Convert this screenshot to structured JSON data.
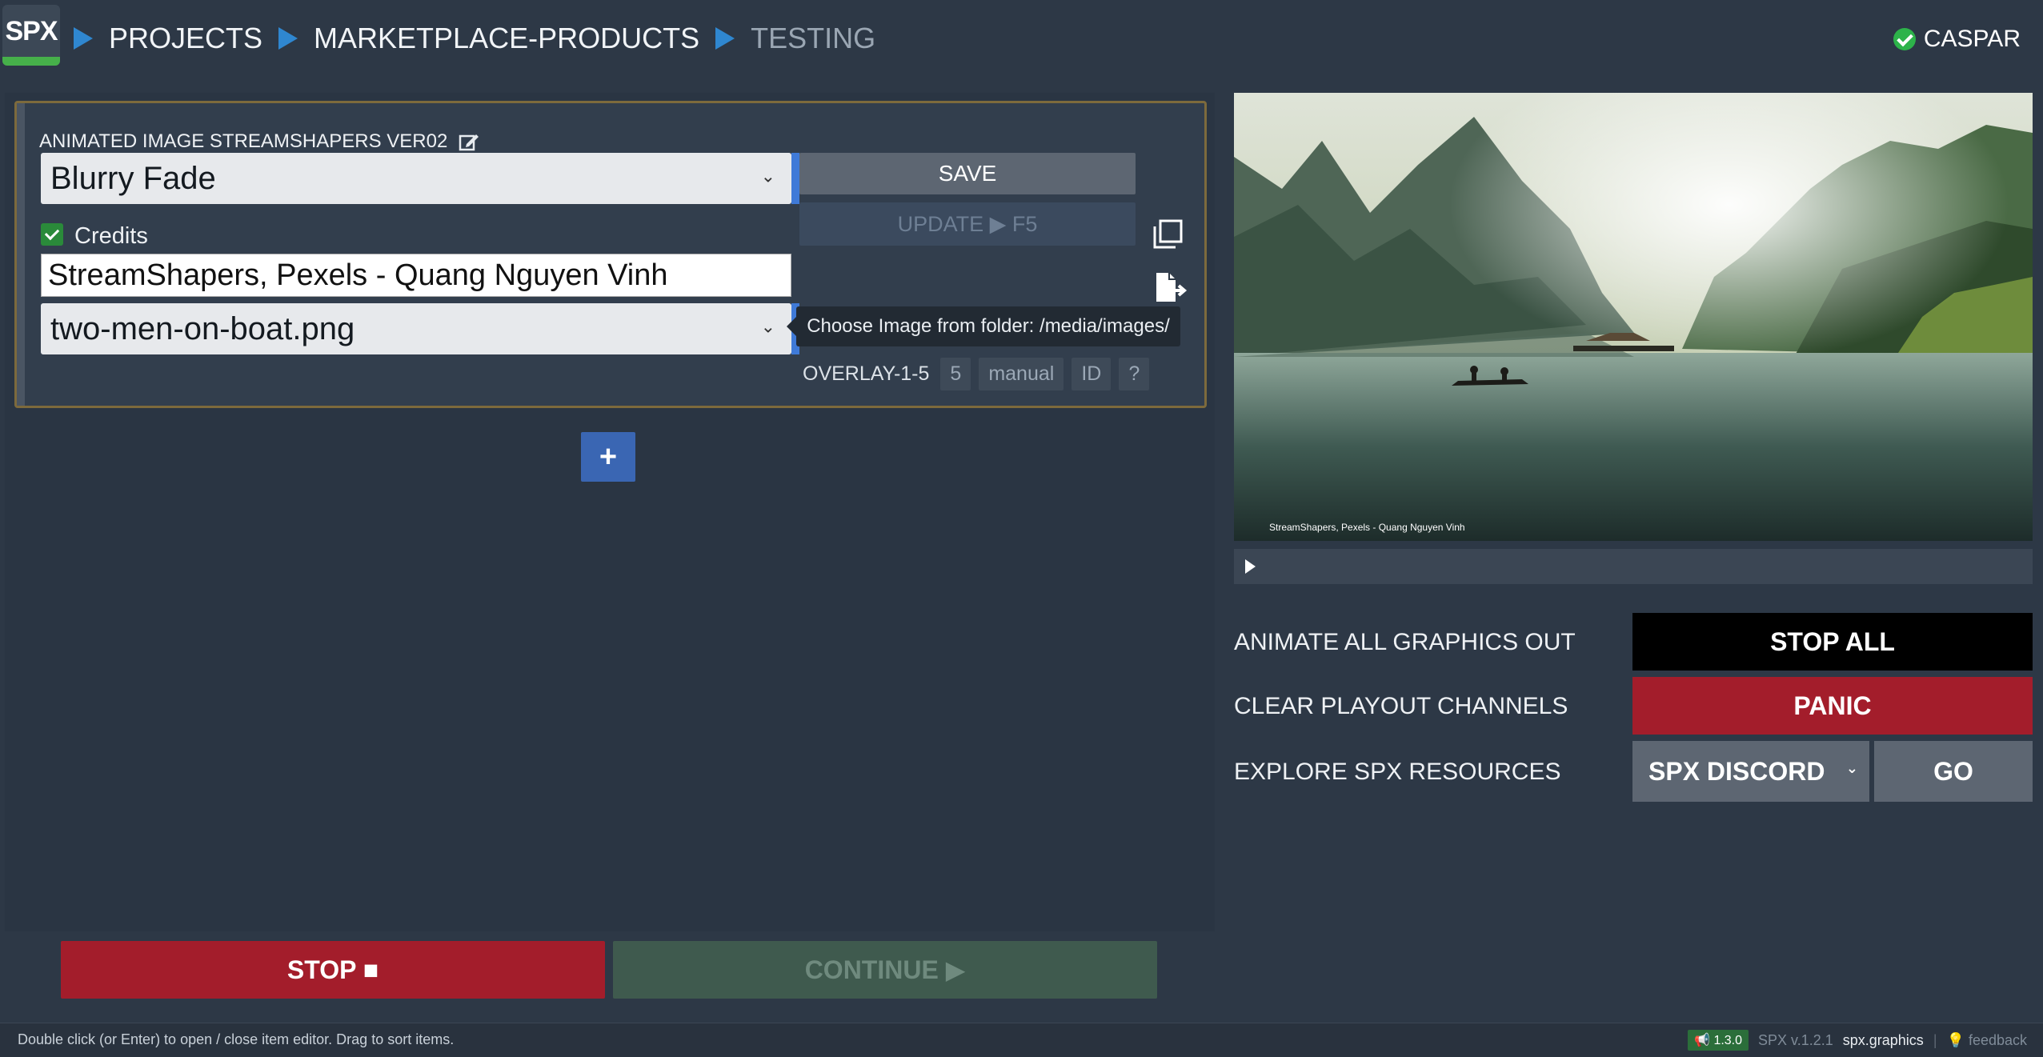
{
  "header": {
    "logo": "SPX",
    "breadcrumbs": [
      "PROJECTS",
      "MARKETPLACE-PRODUCTS",
      "TESTING"
    ],
    "server_name": "CASPAR"
  },
  "item": {
    "title": "ANIMATED IMAGE STREAMSHAPERS VER02",
    "effect_select": "Blurry Fade",
    "credits_label": "Credits",
    "credits_value": "StreamShapers, Pexels - Quang Nguyen Vinh",
    "image_select": "two-men-on-boat.png",
    "save_label": "SAVE",
    "update_label": "UPDATE ▶ F5",
    "tooltip": "Choose Image from folder: /media/images/",
    "layer": "OVERLAY-1-5",
    "channel_layer": "5",
    "mode": "manual",
    "id_label": "ID",
    "help_label": "?"
  },
  "add_label": "+",
  "bottom": {
    "stop_label": "STOP ■",
    "continue_label": "CONTINUE ▶"
  },
  "preview": {
    "caption": "StreamShapers, Pexels - Quang Nguyen Vinh"
  },
  "controls": {
    "animate_out_label": "ANIMATE ALL GRAPHICS OUT",
    "stop_all_label": "STOP ALL",
    "clear_label": "CLEAR PLAYOUT CHANNELS",
    "panic_label": "PANIC",
    "explore_label": "EXPLORE SPX RESOURCES",
    "resource_selected": "SPX DISCORD",
    "go_label": "GO"
  },
  "footer": {
    "hint": "Double click (or Enter) to open / close item editor. Drag to sort items.",
    "badge": "1.3.0",
    "version": "SPX v.1.2.1",
    "site": "spx.graphics",
    "feedback": "feedback"
  },
  "colors": {
    "background": "#2d3846",
    "accent_blue": "#2f87d0",
    "stop_red": "#a31d2b",
    "ok_green": "#2db34a"
  }
}
